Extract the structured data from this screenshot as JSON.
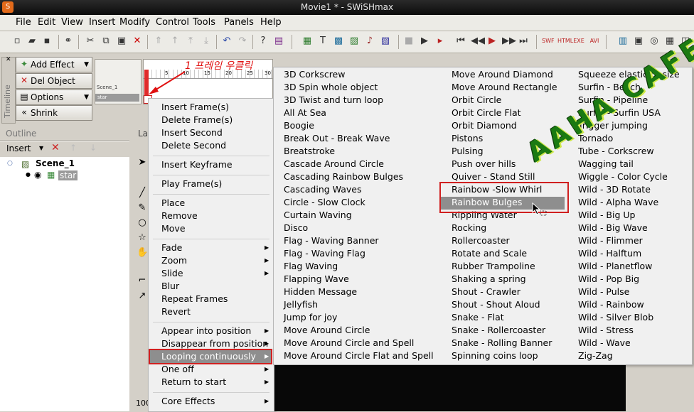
{
  "window": {
    "title": "Movie1 * - SWiSHmax"
  },
  "menubar": [
    "File",
    "Edit",
    "View",
    "Insert",
    "Modify",
    "Control",
    "Tools",
    "Panels",
    "Help"
  ],
  "timeline_panel": {
    "tab_label": "Timeline",
    "buttons": {
      "add_effect": "Add Effect",
      "del_object": "Del Object",
      "options": "Options",
      "shrink": "Shrink"
    },
    "scenes": [
      "Scene_1",
      "star"
    ],
    "frame_numbers": [
      "1",
      "5",
      "10",
      "15",
      "20",
      "25",
      "30"
    ]
  },
  "annotation": {
    "note": "1 프레임 우클릭"
  },
  "outline": {
    "header": "Outline",
    "insert_label": "Insert",
    "tree": {
      "scene": "Scene_1",
      "object": "star"
    }
  },
  "tools_col": {
    "tab_label": "La",
    "bottom_label": "100"
  },
  "context_menu": {
    "group1": [
      "Insert Frame(s)",
      "Delete Frame(s)",
      "Insert Second",
      "Delete Second"
    ],
    "group2": [
      "Insert Keyframe"
    ],
    "group3": [
      "Play Frame(s)"
    ],
    "group4": [
      "Place",
      "Remove",
      "Move"
    ],
    "group5": [
      "Fade",
      "Zoom",
      "Slide",
      "Blur",
      "Repeat Frames",
      "Revert"
    ],
    "group6": [
      "Appear into position",
      "Disappear from position",
      "Looping continuously",
      "One off",
      "Return to start"
    ],
    "group7": [
      "Core Effects"
    ]
  },
  "effects_submenu": {
    "col1": [
      "3D Corkscrew",
      "3D Spin whole object",
      "3D Twist and turn loop",
      "All At Sea",
      "Boogie",
      "Break Out - Break Wave",
      "Breatstroke",
      "Cascade Around Circle",
      "Cascading Rainbow Bulges",
      "Cascading Waves",
      "Circle - Slow Clock",
      "Curtain Waving",
      "Disco",
      "Flag - Waving Banner",
      "Flag - Waving Flag",
      "Flag Waving",
      "Flapping Wave",
      "Hidden Message",
      "Jellyfish",
      "Jump for joy",
      "Move Around Circle",
      "Move Around Circle and Spell",
      "Move Around Circle Flat and Spell"
    ],
    "col2": [
      "Move Around Diamond",
      "Move Around Rectangle",
      "Orbit Circle",
      "Orbit Circle Flat",
      "Orbit Diamond",
      "Pistons",
      "Pulsing",
      "Push over hills",
      "Quiver - Stand Still",
      "Rainbow -Slow Whirl",
      "Rainbow Bulges",
      "Rippling Water",
      "Rocking",
      "Rollercoaster",
      "Rotate and Scale",
      "Rubber Trampoline",
      "Shaking a spring",
      "Shout - Crawler",
      "Shout - Shout Aloud",
      "Snake - Flat",
      "Snake - Rollercoaster",
      "Snake - Rolling Banner",
      "Spinning coins loop"
    ],
    "col3": [
      "Squeeze elastic to size",
      "Surfin - Beach",
      "Surfin - Pipeline",
      "Surfin - Surfin USA",
      "Trigger jumping",
      "Tornado",
      "Tube - Corkscrew",
      "Wagging tail",
      "Wiggle - Color Cycle",
      "Wild - 3D Rotate",
      "Wild - Alpha Wave",
      "Wild - Big Up",
      "Wild - Big Wave",
      "Wild - Flimmer",
      "Wild - Halftum",
      "Wild - Planetflow",
      "Wild - Pop Big",
      "Wild - Pulse",
      "Wild - Rainbow",
      "Wild - Silver Blob",
      "Wild - Stress",
      "Wild - Wave",
      "Zig-Zag"
    ]
  },
  "watermark": "AAHA CAFE"
}
